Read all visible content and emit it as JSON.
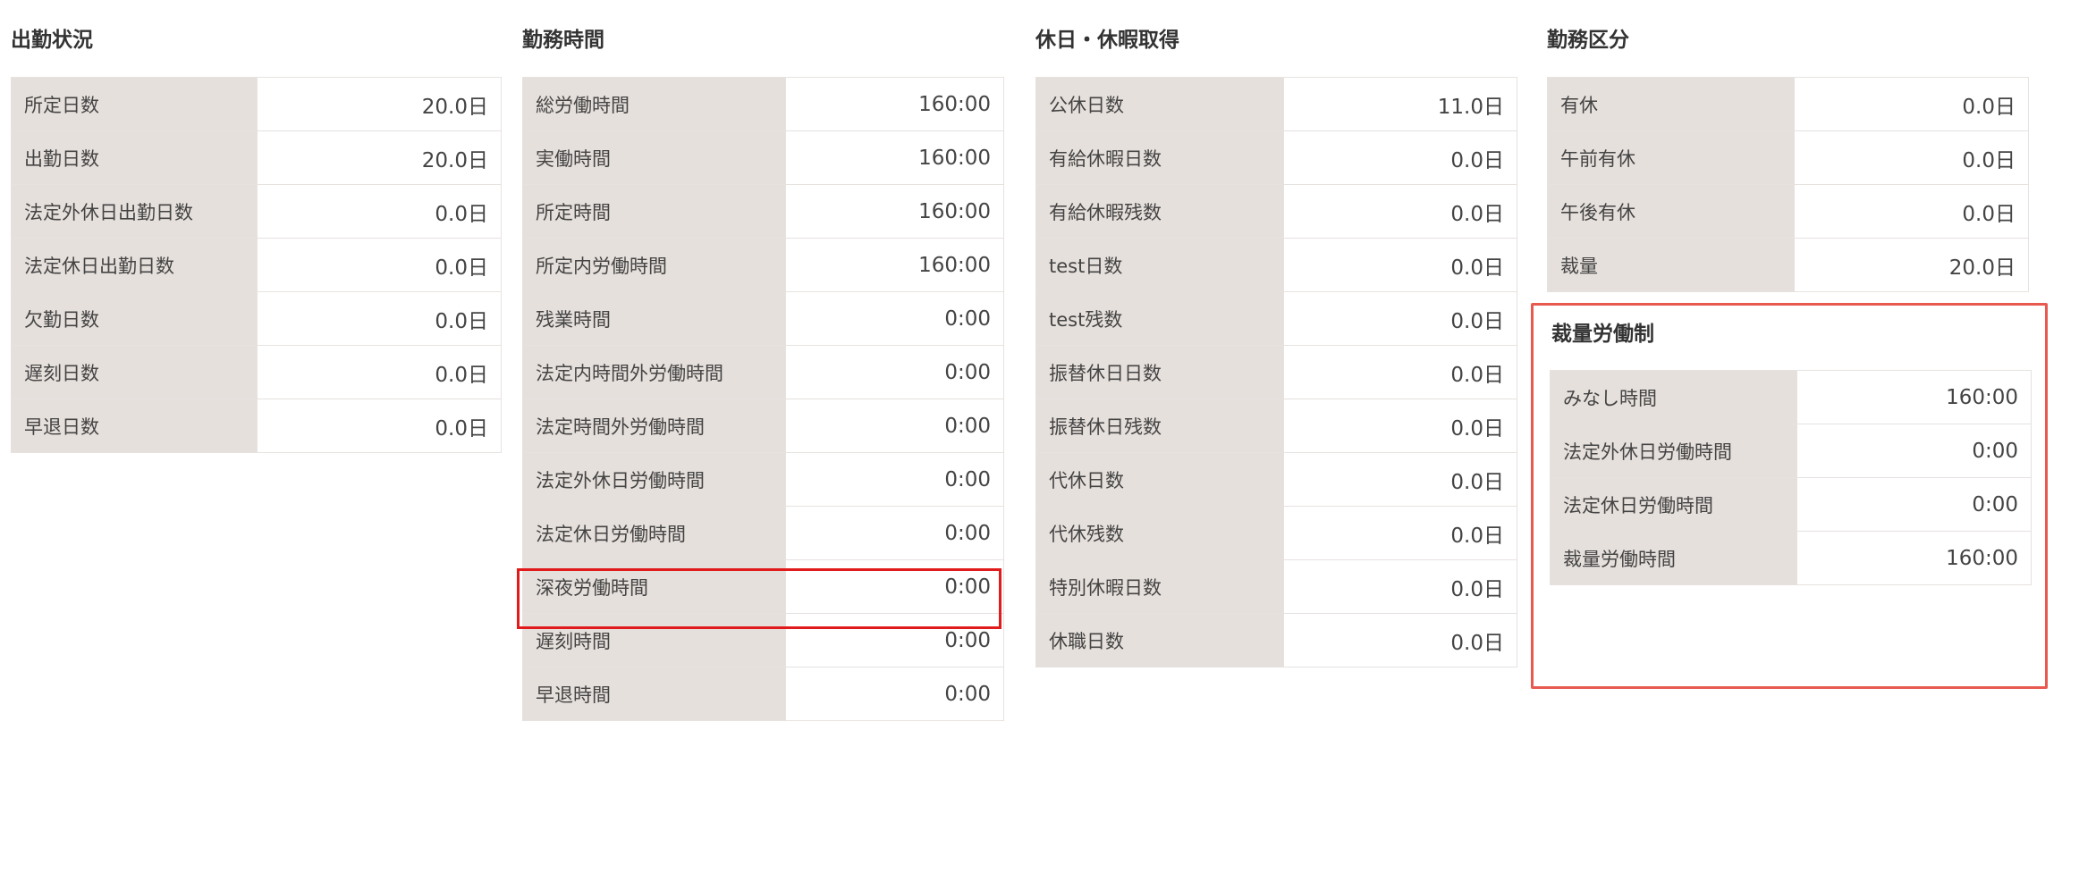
{
  "sections": {
    "attendance": {
      "title": "出勤状況",
      "rows": [
        {
          "label": "所定日数",
          "value": "20.0日"
        },
        {
          "label": "出勤日数",
          "value": "20.0日"
        },
        {
          "label": "法定外休日出勤日数",
          "value": "0.0日"
        },
        {
          "label": "法定休日出勤日数",
          "value": "0.0日"
        },
        {
          "label": "欠勤日数",
          "value": "0.0日"
        },
        {
          "label": "遅刻日数",
          "value": "0.0日"
        },
        {
          "label": "早退日数",
          "value": "0.0日"
        }
      ]
    },
    "worktime": {
      "title": "勤務時間",
      "rows": [
        {
          "label": "総労働時間",
          "value": "160:00"
        },
        {
          "label": "実働時間",
          "value": "160:00"
        },
        {
          "label": "所定時間",
          "value": "160:00"
        },
        {
          "label": "所定内労働時間",
          "value": "160:00"
        },
        {
          "label": "残業時間",
          "value": "0:00"
        },
        {
          "label": "法定内時間外労働時間",
          "value": "0:00"
        },
        {
          "label": "法定時間外労働時間",
          "value": "0:00"
        },
        {
          "label": "法定外休日労働時間",
          "value": "0:00"
        },
        {
          "label": "法定休日労働時間",
          "value": "0:00"
        },
        {
          "label": "深夜労働時間",
          "value": "0:00"
        },
        {
          "label": "遅刻時間",
          "value": "0:00"
        },
        {
          "label": "早退時間",
          "value": "0:00"
        }
      ]
    },
    "holiday": {
      "title": "休日・休暇取得",
      "rows": [
        {
          "label": "公休日数",
          "value": "11.0日"
        },
        {
          "label": "有給休暇日数",
          "value": "0.0日"
        },
        {
          "label": "有給休暇残数",
          "value": "0.0日"
        },
        {
          "label": "test日数",
          "value": "0.0日"
        },
        {
          "label": "test残数",
          "value": "0.0日"
        },
        {
          "label": "振替休日日数",
          "value": "0.0日"
        },
        {
          "label": "振替休日残数",
          "value": "0.0日"
        },
        {
          "label": "代休日数",
          "value": "0.0日"
        },
        {
          "label": "代休残数",
          "value": "0.0日"
        },
        {
          "label": "特別休暇日数",
          "value": "0.0日"
        },
        {
          "label": "休職日数",
          "value": "0.0日"
        }
      ]
    },
    "workclass": {
      "title": "勤務区分",
      "rows": [
        {
          "label": "有休",
          "value": "0.0日"
        },
        {
          "label": "午前有休",
          "value": "0.0日"
        },
        {
          "label": "午後有休",
          "value": "0.0日"
        },
        {
          "label": "裁量",
          "value": "20.0日"
        }
      ]
    },
    "discretionary": {
      "title": "裁量労働制",
      "rows": [
        {
          "label": "みなし時間",
          "value": "160:00"
        },
        {
          "label": "法定外休日労働時間",
          "value": "0:00"
        },
        {
          "label": "法定休日労働時間",
          "value": "0:00"
        },
        {
          "label": "裁量労働時間",
          "value": "160:00"
        }
      ]
    }
  },
  "colors": {
    "label_bg": "#e6e0dc",
    "highlight_red": "#e11b1b",
    "highlight_box": "#e85a50"
  }
}
